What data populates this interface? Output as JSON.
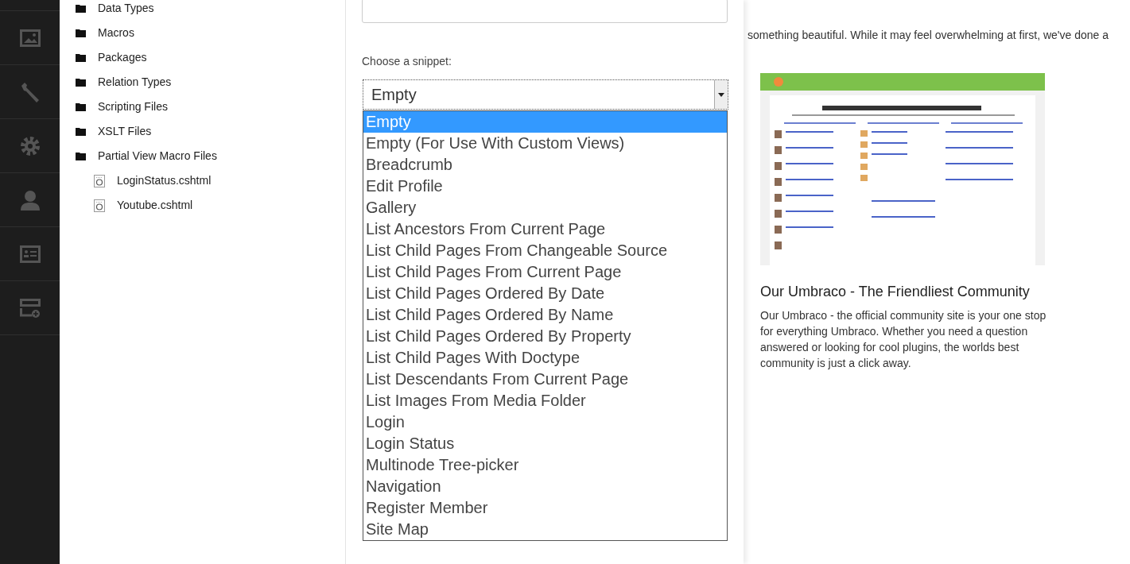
{
  "nav_sections": [
    {
      "kind": "media"
    },
    {
      "kind": "wrench"
    },
    {
      "kind": "gear"
    },
    {
      "kind": "user"
    },
    {
      "kind": "card"
    },
    {
      "kind": "form"
    }
  ],
  "tree": {
    "items": [
      {
        "label": "Data Types",
        "kind": "folder"
      },
      {
        "label": "Macros",
        "kind": "folder"
      },
      {
        "label": "Packages",
        "kind": "folder"
      },
      {
        "label": "Relation Types",
        "kind": "folder"
      },
      {
        "label": "Scripting Files",
        "kind": "folder"
      },
      {
        "label": "XSLT Files",
        "kind": "folder"
      },
      {
        "label": "Partial View Macro Files",
        "kind": "folder",
        "children": [
          {
            "label": "LoginStatus.cshtml",
            "kind": "file"
          },
          {
            "label": "Youtube.cshtml",
            "kind": "file"
          }
        ]
      }
    ]
  },
  "editor": {
    "snippet_label": "Choose a snippet:",
    "snippet_value": "Empty",
    "snippet_options": [
      {
        "label": "Empty",
        "selected": true
      },
      {
        "label": "Empty (For Use With Custom Views)",
        "selected": false
      },
      {
        "label": "Breadcrumb",
        "selected": false
      },
      {
        "label": "Edit Profile",
        "selected": false
      },
      {
        "label": "Gallery",
        "selected": false
      },
      {
        "label": "List Ancestors From Current Page",
        "selected": false
      },
      {
        "label": "List Child Pages From Changeable Source",
        "selected": false
      },
      {
        "label": "List Child Pages From Current Page",
        "selected": false
      },
      {
        "label": "List Child Pages Ordered By Date",
        "selected": false
      },
      {
        "label": "List Child Pages Ordered By Name",
        "selected": false
      },
      {
        "label": "List Child Pages Ordered By Property",
        "selected": false
      },
      {
        "label": "List Child Pages With Doctype",
        "selected": false
      },
      {
        "label": "List Descendants From Current Page",
        "selected": false
      },
      {
        "label": "List Images From Media Folder",
        "selected": false
      },
      {
        "label": "Login",
        "selected": false
      },
      {
        "label": "Login Status",
        "selected": false
      },
      {
        "label": "Multinode Tree-picker",
        "selected": false
      },
      {
        "label": "Navigation",
        "selected": false
      },
      {
        "label": "Register Member",
        "selected": false
      },
      {
        "label": "Site Map",
        "selected": false
      }
    ]
  },
  "dashboard": {
    "intro_text": "something beautiful. While it may feel overwhelming at first, we've done a",
    "card_title": "Our Umbraco - The Friendliest Community",
    "card_text": "Our Umbraco - the official community site is your one stop for everything Umbraco. Whether you need a question answered or looking for cool plugins, the worlds best community is just a click away."
  }
}
